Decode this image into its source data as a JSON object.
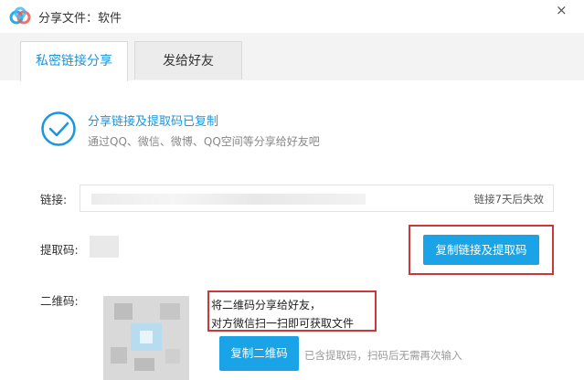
{
  "window": {
    "title": "分享文件：软件",
    "close_glyph": "×"
  },
  "tabs": [
    {
      "label": "私密链接分享",
      "active": true
    },
    {
      "label": "发给好友",
      "active": false
    }
  ],
  "success": {
    "title": "分享链接及提取码已复制",
    "subtitle": "通过QQ、微信、微博、QQ空间等分享给好友吧"
  },
  "link": {
    "label": "链接:",
    "expiry": "链接7天后失效"
  },
  "code": {
    "label": "提取码:",
    "copy_button": "复制链接及提取码"
  },
  "qr": {
    "label": "二维码:",
    "note_line1": "将二维码分享给好友，",
    "note_line2": "对方微信扫一扫即可获取文件",
    "copy_button": "复制二维码",
    "hint": "已含提取码，扫码后无需再次输入"
  },
  "colors": {
    "accent": "#1aa3e6",
    "highlight_frame": "#c9383a"
  }
}
